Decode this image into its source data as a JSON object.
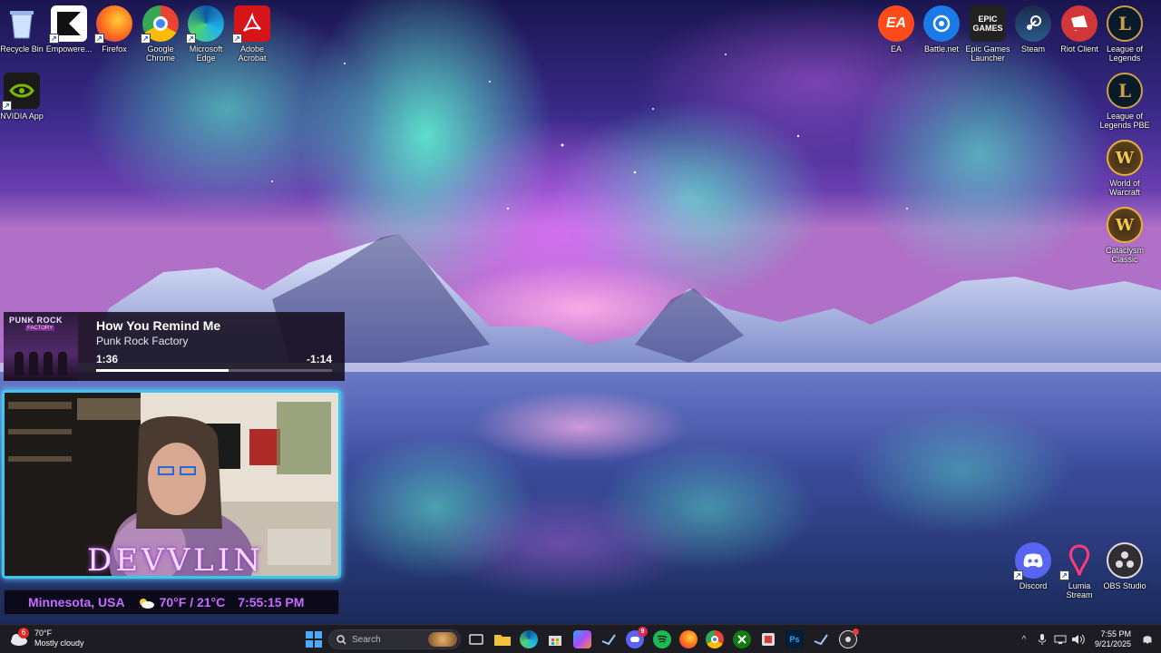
{
  "desktop": {
    "left_icons": [
      {
        "label": "Recycle Bin",
        "icon": "recycle-bin-icon"
      },
      {
        "label": "Empowere...",
        "icon": "empowered-icon"
      },
      {
        "label": "Firefox",
        "icon": "firefox-icon"
      },
      {
        "label": "Google\nChrome",
        "icon": "chrome-icon"
      },
      {
        "label": "Microsoft\nEdge",
        "icon": "edge-icon"
      },
      {
        "label": "Adobe\nAcrobat",
        "icon": "acrobat-icon"
      },
      {
        "label": "NVIDIA App",
        "icon": "nvidia-icon"
      }
    ],
    "right_icons": [
      {
        "label": "EA",
        "icon": "ea-icon",
        "glyph": "EA"
      },
      {
        "label": "Battle.net",
        "icon": "battlenet-icon"
      },
      {
        "label": "Epic Games\nLauncher",
        "icon": "epic-games-icon",
        "glyph": "EPIC\nGAMES"
      },
      {
        "label": "Steam",
        "icon": "steam-icon"
      },
      {
        "label": "Riot Client",
        "icon": "riot-client-icon"
      },
      {
        "label": "League of\nLegends",
        "icon": "league-of-legends-icon",
        "glyph": "L"
      },
      {
        "label": "League of\nLegends PBE",
        "icon": "league-pbe-icon",
        "glyph": "L"
      },
      {
        "label": "World of\nWarcraft",
        "icon": "world-of-warcraft-icon",
        "glyph": "W"
      },
      {
        "label": "Cataclysm\nClassic",
        "icon": "cataclysm-classic-icon",
        "glyph": "W"
      },
      {
        "label": "Discord",
        "icon": "discord-icon"
      },
      {
        "label": "Lumia\nStream",
        "icon": "lumia-stream-icon"
      },
      {
        "label": "OBS Studio",
        "icon": "obs-studio-icon"
      }
    ]
  },
  "now_playing": {
    "title": "How You Remind Me",
    "artist": "Punk Rock Factory",
    "elapsed": "1:36",
    "remaining": "-1:14",
    "progress": 0.56,
    "art_text_1": "PUNK ROCK",
    "art_text_2": "FACTORY"
  },
  "overlay": {
    "brand": "DEVVLIN",
    "location": "Minnesota, USA",
    "temperature": "70°F / 21°C",
    "time": "7:55:15 PM"
  },
  "taskbar": {
    "weather_badge": "6",
    "weather_temp": "70°F",
    "weather_desc": "Mostly cloudy",
    "search_placeholder": "Search",
    "apps": [
      "start-icon",
      "search",
      "task-view-icon",
      "file-explorer-icon",
      "edge-icon",
      "store-icon",
      "copilot-icon",
      "steam-icon",
      "discord-icon",
      "spotify-icon",
      "firefox-icon",
      "chrome-icon",
      "xbox-icon",
      "snip-icon",
      "photoshop-icon",
      "steam-icon",
      "obs-icon"
    ],
    "discord_badge": "9",
    "clock_time": "7:55 PM",
    "clock_date": "9/21/2025"
  },
  "colors": {
    "accent_cyan": "#3ec6f0",
    "overlay_purple": "#c86bff",
    "taskbar_bg": "#1c1c22"
  }
}
